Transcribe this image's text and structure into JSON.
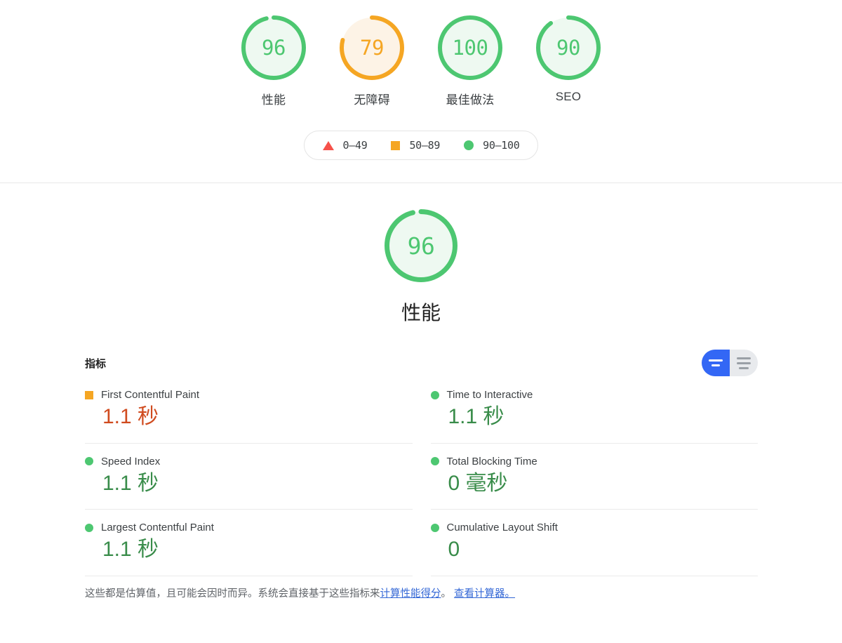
{
  "scores": {
    "gauges": [
      {
        "value": "96",
        "label": "性能",
        "pct": 96,
        "state": "pass"
      },
      {
        "value": "79",
        "label": "无障碍",
        "pct": 79,
        "state": "average"
      },
      {
        "value": "100",
        "label": "最佳做法",
        "pct": 100,
        "state": "pass"
      },
      {
        "value": "90",
        "label": "SEO",
        "pct": 90,
        "state": "pass"
      }
    ]
  },
  "legend": {
    "items": [
      {
        "shape": "triangle-icon",
        "range": "0–49"
      },
      {
        "shape": "square-icon",
        "range": "50–89"
      },
      {
        "shape": "circle-icon",
        "range": "90–100"
      }
    ]
  },
  "category": {
    "score": "96",
    "pct": 96,
    "state": "pass",
    "title": "性能"
  },
  "metrics": {
    "heading": "指标",
    "toggle": {
      "simple_label": "simple-view-icon",
      "detail_label": "detail-view-icon",
      "active": "simple"
    },
    "items": [
      {
        "name": "First Contentful Paint",
        "value": "1.1 秒",
        "marker": "square-icon",
        "tone": "orange"
      },
      {
        "name": "Time to Interactive",
        "value": "1.1 秒",
        "marker": "circle-icon",
        "tone": "green"
      },
      {
        "name": "Speed Index",
        "value": "1.1 秒",
        "marker": "circle-icon",
        "tone": "green"
      },
      {
        "name": "Total Blocking Time",
        "value": "0 毫秒",
        "marker": "circle-icon",
        "tone": "green"
      },
      {
        "name": "Largest Contentful Paint",
        "value": "1.1 秒",
        "marker": "circle-icon",
        "tone": "green"
      },
      {
        "name": "Cumulative Layout Shift",
        "value": "0",
        "marker": "circle-icon",
        "tone": "green"
      }
    ],
    "note": {
      "text_before": "这些都是估算值，且可能会因时而异。系统会直接基于这些指标来",
      "link1": "计算性能得分",
      "text_middle": "。 ",
      "link2": "查看计算器。"
    }
  },
  "colors": {
    "pass": "#4dc771",
    "pass_fill": "#eef9f1",
    "average": "#f5a623",
    "average_fill": "#fdf3e6",
    "fail": "#f6514a",
    "blue": "#3367f5",
    "link": "#3367d6"
  }
}
